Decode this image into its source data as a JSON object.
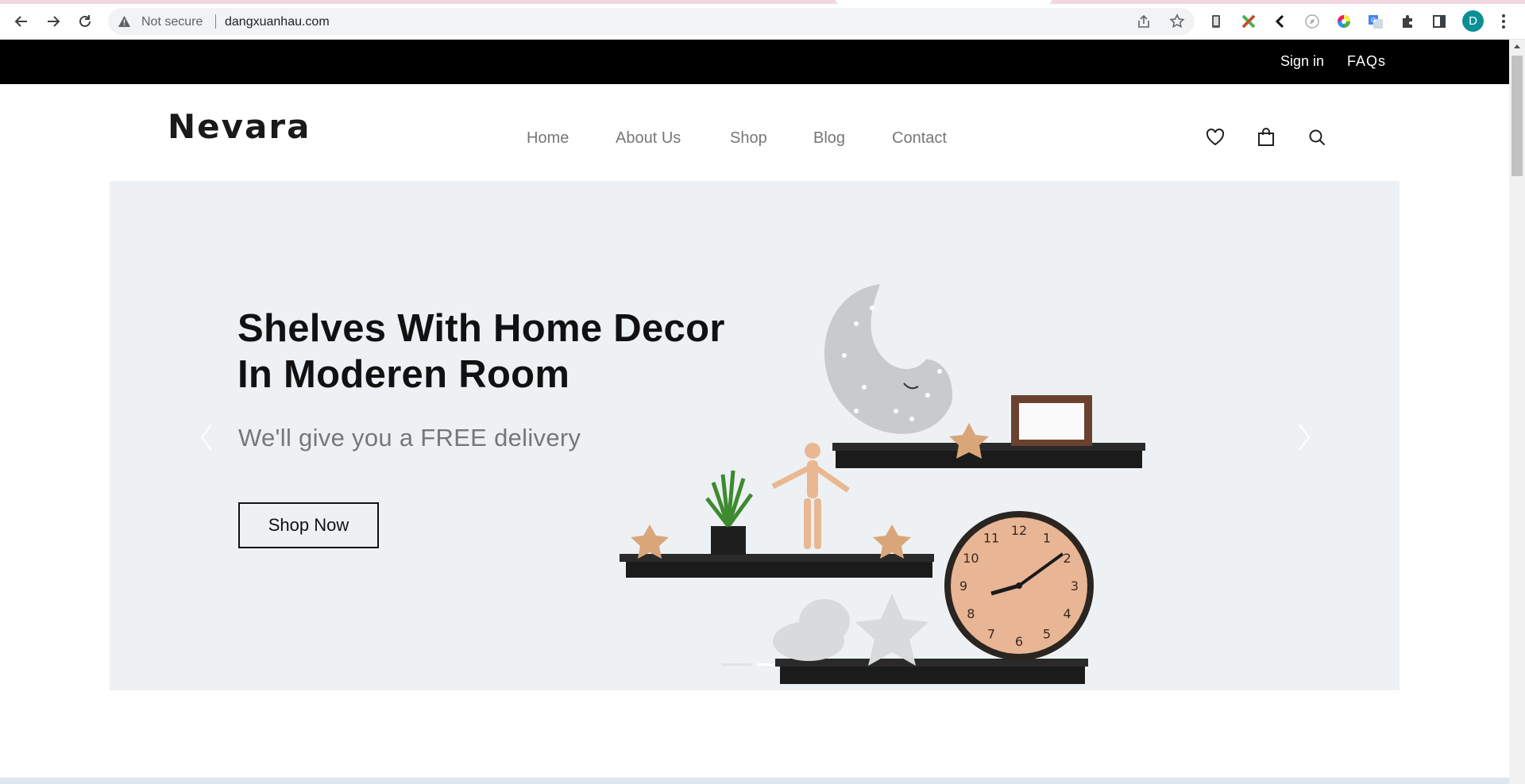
{
  "browser": {
    "security_label": "Not secure",
    "url": "dangxuanhau.com",
    "profile_initial": "D"
  },
  "topbar": {
    "sign_in": "Sign in",
    "faqs": "FAQs"
  },
  "header": {
    "logo": "Nevara",
    "nav": [
      "Home",
      "About Us",
      "Shop",
      "Blog",
      "Contact"
    ]
  },
  "hero": {
    "title_line1": "Shelves With Home Decor",
    "title_line2": "In Moderen Room",
    "subtitle": "We'll give you a FREE delivery",
    "cta": "Shop Now",
    "slides_count": 2,
    "active_slide": 2
  },
  "clock_numbers": [
    "12",
    "1",
    "2",
    "3",
    "4",
    "5",
    "6",
    "7",
    "8",
    "9",
    "10",
    "11"
  ],
  "colors": {
    "topbar_bg": "#000000",
    "hero_bg": "#edf1f3",
    "nav_text": "#777777",
    "accent_avatar": "#0b8f93"
  }
}
